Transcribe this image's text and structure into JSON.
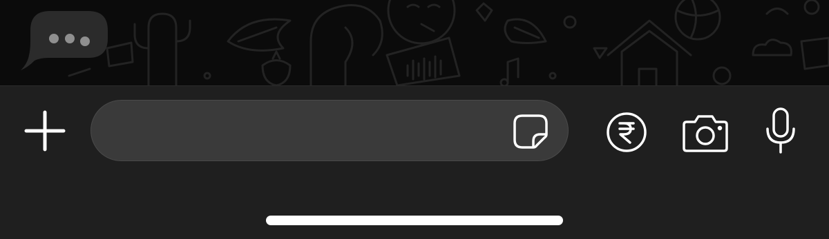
{
  "chat": {
    "typing_indicator": {
      "icon": "typing-dots-icon",
      "dot_color": "#8f8f8f",
      "bubble_color": "#2b2b2b"
    }
  },
  "composer": {
    "attach_icon": "plus-icon",
    "message_placeholder": "",
    "message_value": "",
    "sticker_icon": "sticker-icon",
    "payment_icon": "rupee-icon",
    "camera_icon": "camera-icon",
    "mic_icon": "microphone-icon"
  },
  "colors": {
    "chat_background": "#0b0b0b",
    "doodle_stroke": "#222222",
    "composer_background": "#1f1f1f",
    "input_background": "#3a3a3a",
    "icon_color": "#ffffff",
    "home_indicator": "#ffffff"
  }
}
